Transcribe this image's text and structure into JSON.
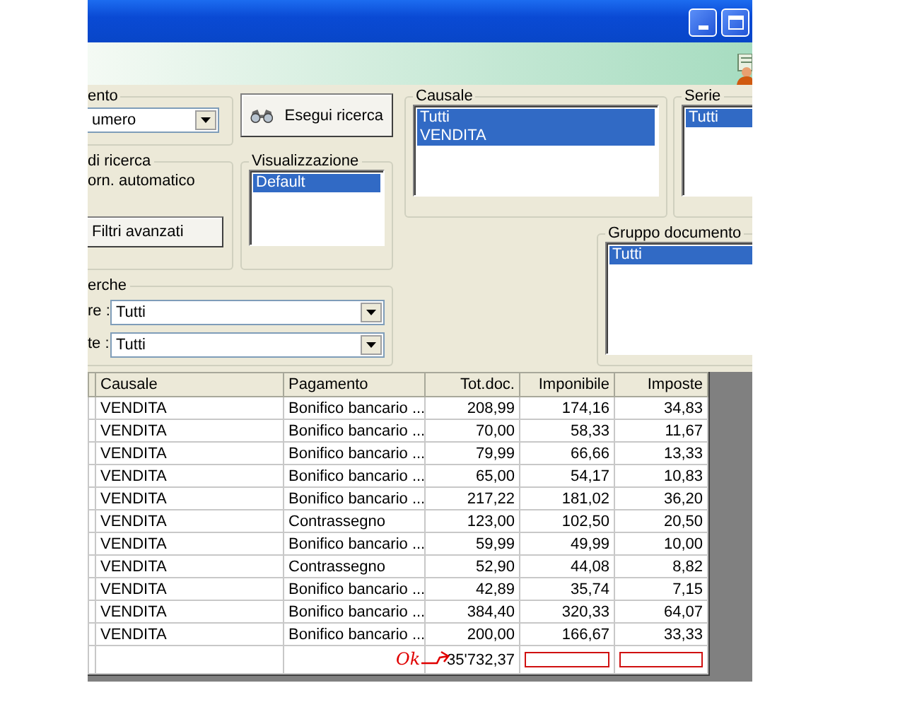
{
  "filters": {
    "document": {
      "label": "ento",
      "value": "umero"
    },
    "search_button": "Esegui ricerca",
    "search_mode": {
      "label": "di ricerca",
      "option": "orn. automatico",
      "advanced_button": "Filtri avanzati"
    },
    "view": {
      "label": "Visualizzazione",
      "items": [
        {
          "label": "Default",
          "selected": true
        }
      ]
    },
    "causale": {
      "label": "Causale",
      "items": [
        {
          "label": "Tutti",
          "selected": true
        },
        {
          "label": "VENDITA",
          "selected": true
        }
      ]
    },
    "serie": {
      "label": "Serie",
      "items": [
        {
          "label": "Tutti",
          "selected": true
        }
      ]
    },
    "document_group": {
      "label": "Gruppo documento",
      "items": [
        {
          "label": "Tutti",
          "selected": true
        }
      ]
    },
    "searches": {
      "label": "erche",
      "fields": [
        {
          "label": "re :",
          "value": "Tutti"
        },
        {
          "label": "te :",
          "value": "Tutti"
        }
      ]
    }
  },
  "table": {
    "columns": [
      "Causale",
      "Pagamento",
      "Tot.doc.",
      "Imponibile",
      "Imposte"
    ],
    "rows": [
      [
        "VENDITA",
        "Bonifico bancario ...",
        "208,99",
        "174,16",
        "34,83"
      ],
      [
        "VENDITA",
        "Bonifico bancario ...",
        "70,00",
        "58,33",
        "11,67"
      ],
      [
        "VENDITA",
        "Bonifico bancario ...",
        "79,99",
        "66,66",
        "13,33"
      ],
      [
        "VENDITA",
        "Bonifico bancario ...",
        "65,00",
        "54,17",
        "10,83"
      ],
      [
        "VENDITA",
        "Bonifico bancario ...",
        "217,22",
        "181,02",
        "36,20"
      ],
      [
        "VENDITA",
        "Contrassegno",
        "123,00",
        "102,50",
        "20,50"
      ],
      [
        "VENDITA",
        "Bonifico bancario ...",
        "59,99",
        "49,99",
        "10,00"
      ],
      [
        "VENDITA",
        "Contrassegno",
        "52,90",
        "44,08",
        "8,82"
      ],
      [
        "VENDITA",
        "Bonifico bancario ...",
        "42,89",
        "35,74",
        "7,15"
      ],
      [
        "VENDITA",
        "Bonifico bancario ...",
        "384,40",
        "320,33",
        "64,07"
      ],
      [
        "VENDITA",
        "Bonifico bancario ...",
        "200,00",
        "166,67",
        "33,33"
      ]
    ],
    "totals": {
      "tot_doc": "35'732,37"
    }
  },
  "annotation": {
    "text": "Ok"
  }
}
